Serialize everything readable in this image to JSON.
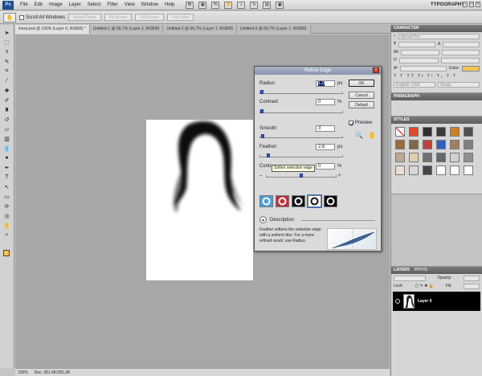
{
  "menubar": {
    "logo": "Ps",
    "items": [
      "File",
      "Edit",
      "Image",
      "Layer",
      "Select",
      "Filter",
      "View",
      "Window",
      "Help"
    ],
    "workspace": "TYPOGRAPHY",
    "window_buttons": [
      "–",
      "□",
      "×"
    ]
  },
  "options": {
    "scroll_all_label": "Scroll All Windows",
    "buttons": [
      "Actual Pixels",
      "Fit Screen",
      "Fill Screen",
      "Print Size"
    ]
  },
  "tabs": [
    "loera.psd @ 100% (Layer 0, RGB/8) *",
    "Untitled-1 @ 66,7% (Layer 1, RGB/8)",
    "Untitled-2 @ 66,7% (Layer 1, RGB/8)",
    "Untitled-3 @ 66,7% (Layer 1, RGB/8)"
  ],
  "status": {
    "zoom": "100%",
    "doc": "Doc: 351,6K/351,6K"
  },
  "panels": {
    "character": "CHARACTER",
    "paragraph": "PARAGRAPH",
    "styles": "STYLES",
    "layers_tabs": [
      "LAYERS",
      "PATHS"
    ],
    "opacity_label": "Opacity:",
    "lock_label": "Lock:",
    "fill_label": "Fill:",
    "layer_name": "Layer 0",
    "char_color_label": "Color:",
    "char_font": "Myriad Pro",
    "char_language": "English: USA",
    "char_aa": "Sharp",
    "char_color": "#f3c35a"
  },
  "dialog": {
    "title": "Refine Edge",
    "radius_label": "Radius:",
    "radius_value": "1,0",
    "radius_unit": "px",
    "contrast_label": "Contrast:",
    "contrast_value": "0",
    "contrast_unit": "%",
    "smooth_label": "Smooth:",
    "smooth_value": "3",
    "feather_label": "Feather:",
    "feather_value": "2,6",
    "feather_unit": "px",
    "contract_label": "Contract/Expand:",
    "contract_label_visible": "Contr",
    "contract_value": "0",
    "contract_unit": "%",
    "minus": "–",
    "plus": "+",
    "ok": "OK",
    "cancel": "Cancel",
    "default": "Default",
    "preview_label": "Preview",
    "tooltip": "Soften selection edge",
    "description_label": "Description",
    "description_text": "Feather softens the selection edge with a uniform blur. For a more refined result, use Radius.",
    "sliders": {
      "radius": 0.02,
      "contrast": 0,
      "smooth": 0.03,
      "feather": 0.1,
      "contract": 0.5
    },
    "modes": [
      "standard",
      "quick-mask",
      "on-black",
      "on-white",
      "mask"
    ]
  },
  "styles_colors": [
    "#ffffff",
    "#e04a2a",
    "#2f2f2f",
    "#3a3a3a",
    "#d08020",
    "#505050",
    "#9a6a3a",
    "#7d6a48",
    "#c04040",
    "#3060c0",
    "#a08060",
    "#808080",
    "#c0a890",
    "#e0d0b0",
    "#707070",
    "#606870",
    "#d0d0d0",
    "#909090",
    "#eadfcf",
    "#d8d8d8",
    "#444444",
    "#ffffff",
    "#ffffff",
    "#ffffff"
  ],
  "colors": {
    "fg": "#f6c34a",
    "bg": "#ffffff",
    "accent": "#2d5bd1"
  }
}
